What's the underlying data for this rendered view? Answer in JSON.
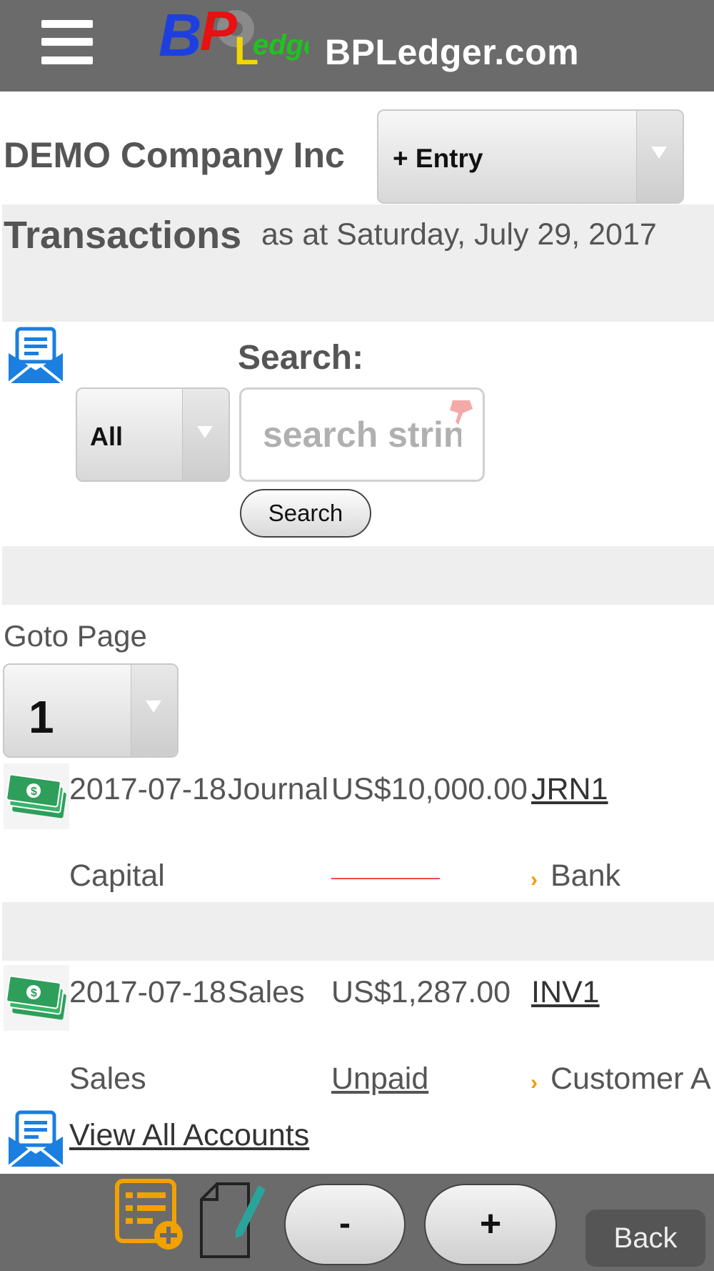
{
  "header": {
    "menu_icon": "hamburger-menu-icon",
    "logo_text": "BPLedger",
    "site_title": "BPLedger.com"
  },
  "company": {
    "name": "DEMO Company Inc",
    "entry_select": "+ Entry"
  },
  "transactions": {
    "title": "Transactions",
    "as_at": "as at Saturday, July 29, 2017"
  },
  "search": {
    "heading": "Search:",
    "filter_value": "All",
    "placeholder": "search string",
    "button_label": "Search"
  },
  "pagination": {
    "label": "Goto Page",
    "current_page": "1"
  },
  "rows": [
    {
      "date": "2017-07-18",
      "type": "Journal",
      "amount": "US$10,000.00",
      "ref": "JRN1",
      "from_account": "Capital",
      "status": "",
      "to_account": "Bank"
    },
    {
      "date": "2017-07-18",
      "type": "Sales",
      "amount": "US$1,287.00",
      "ref": "INV1",
      "from_account": "Sales",
      "status": "Unpaid",
      "to_account": "Customer A"
    }
  ],
  "view_all": "View All Accounts",
  "footer": {
    "minus_label": "-",
    "plus_label": "+",
    "back_label": "Back"
  },
  "colors": {
    "header_bg": "#6b6b6b",
    "band_bg": "#eeeeee",
    "money_green": "#2e9e5b",
    "mail_blue": "#1a7fe0",
    "accent_orange": "#f29b00"
  }
}
